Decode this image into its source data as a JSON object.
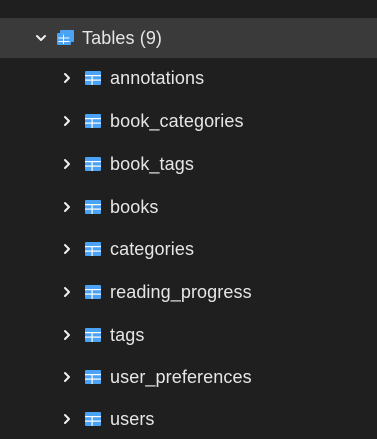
{
  "tree": {
    "parent": {
      "label": "Tables (9)",
      "expanded": true,
      "icon": "tables-icon",
      "caret_icon": "chevron-down-icon"
    },
    "children": [
      {
        "label": "annotations",
        "icon": "table-icon",
        "caret_icon": "chevron-right-icon"
      },
      {
        "label": "book_categories",
        "icon": "table-icon",
        "caret_icon": "chevron-right-icon"
      },
      {
        "label": "book_tags",
        "icon": "table-icon",
        "caret_icon": "chevron-right-icon"
      },
      {
        "label": "books",
        "icon": "table-icon",
        "caret_icon": "chevron-right-icon"
      },
      {
        "label": "categories",
        "icon": "table-icon",
        "caret_icon": "chevron-right-icon"
      },
      {
        "label": "reading_progress",
        "icon": "table-icon",
        "caret_icon": "chevron-right-icon"
      },
      {
        "label": "tags",
        "icon": "table-icon",
        "caret_icon": "chevron-right-icon"
      },
      {
        "label": "user_preferences",
        "icon": "table-icon",
        "caret_icon": "chevron-right-icon"
      },
      {
        "label": "users",
        "icon": "table-icon",
        "caret_icon": "chevron-right-icon"
      }
    ]
  },
  "colors": {
    "background": "#1f1f1f",
    "selected_row": "#3a3a3a",
    "text": "#e6e6e6",
    "icon_blue": "#4aa3f5",
    "icon_white": "#ffffff"
  }
}
